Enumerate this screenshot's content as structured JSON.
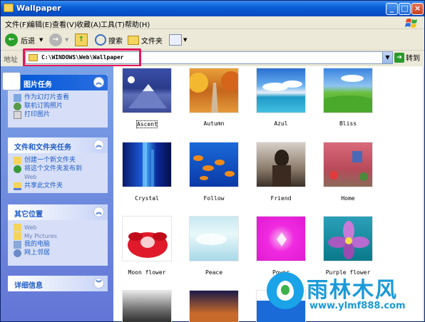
{
  "window": {
    "title": "Wallpaper"
  },
  "menu": [
    "文件(F)",
    "编辑(E)",
    "查看(V)",
    "收藏(A)",
    "工具(T)",
    "帮助(H)"
  ],
  "toolbar": {
    "back": "后退",
    "search": "搜索",
    "folders": "文件夹"
  },
  "address": {
    "label": "地址",
    "path": "C:\\WINDOWS\\Web\\Wallpaper",
    "go": "转到"
  },
  "panels": {
    "picture_tasks": {
      "title": "图片任务",
      "items": [
        "作为幻灯片查看",
        "联机订购照片",
        "打印图片"
      ]
    },
    "file_tasks": {
      "title": "文件和文件夹任务",
      "items": [
        "创建一个新文件夹",
        "将这个文件夹发布到",
        "Web",
        "共享此文件夹"
      ]
    },
    "other_places": {
      "title": "其它位置",
      "items": [
        "Web",
        "My Pictures",
        "我的电脑",
        "网上邻居"
      ]
    },
    "details": {
      "title": "详细信息"
    }
  },
  "thumbnails": [
    "Ascent",
    "Autumn",
    "Azul",
    "Bliss",
    "Crystal",
    "Follow",
    "Friend",
    "Home",
    "Moon flower",
    "Peace",
    "Power",
    "Purple flower"
  ],
  "watermark": {
    "name": "雨林木风",
    "url": "www.ylmf888.com"
  }
}
